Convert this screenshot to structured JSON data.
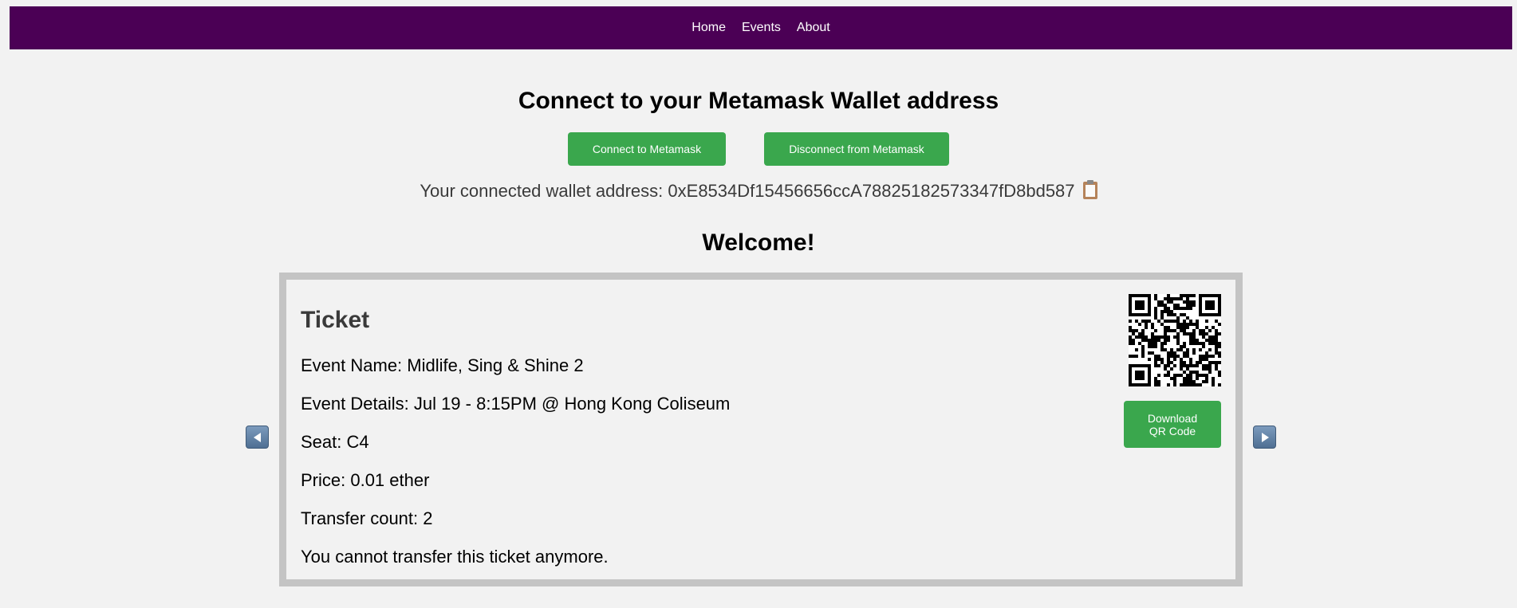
{
  "nav": {
    "items": [
      {
        "label": "Home"
      },
      {
        "label": "Events"
      },
      {
        "label": "About"
      }
    ]
  },
  "connect": {
    "title": "Connect to your Metamask Wallet address",
    "connect_label": "Connect to Metamask",
    "disconnect_label": "Disconnect from Metamask",
    "wallet_prefix": "Your connected wallet address:",
    "wallet_address": "0xE8534Df15456656ccA78825182573347fD8bd587",
    "copy_icon": "clipboard-icon"
  },
  "welcome": "Welcome!",
  "ticket": {
    "title": "Ticket",
    "event_name": "Event Name: Midlife, Sing & Shine 2",
    "event_details": "Event Details: Jul 19 - 8:15PM @ Hong Kong Coliseum",
    "seat": "Seat: C4",
    "price": "Price: 0.01 ether",
    "transfer_count": "Transfer count: 2",
    "transfer_note": "You cannot transfer this ticket anymore.",
    "download_line1": "Download",
    "download_line2": "QR Code"
  },
  "carousel": {
    "prev_icon": "arrow-left-icon",
    "next_icon": "arrow-right-icon"
  },
  "colors": {
    "nav_bg": "#4b0055",
    "button_green": "#3aa74d",
    "card_border": "#c4c4c4",
    "page_bg": "#f2f2f2"
  }
}
